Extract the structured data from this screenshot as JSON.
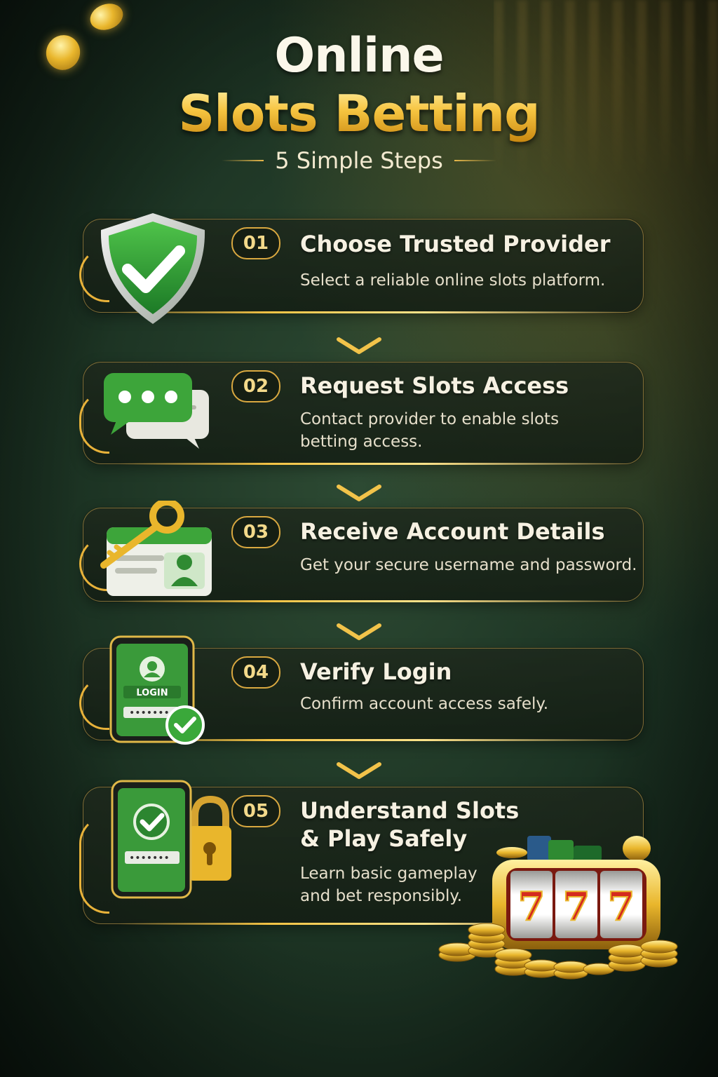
{
  "header": {
    "title_line1": "Online",
    "title_line2": "Slots Betting",
    "subtitle": "5 Simple Steps"
  },
  "steps": [
    {
      "number": "01",
      "title": "Choose Trusted Provider",
      "description": "Select a reliable online slots platform.",
      "icon": "shield-check-icon"
    },
    {
      "number": "02",
      "title": "Request Slots Access",
      "description": "Contact provider to enable slots\nbetting access.",
      "icon": "chat-bubbles-icon"
    },
    {
      "number": "03",
      "title": "Receive Account Details",
      "description": "Get your secure username and password.",
      "icon": "key-id-card-icon"
    },
    {
      "number": "04",
      "title": "Verify Login",
      "description": "Confirm account access safely.",
      "icon": "phone-login-icon",
      "icon_text": "LOGIN"
    },
    {
      "number": "05",
      "title": "Understand Slots\n& Play Safely",
      "description": "Learn basic gameplay\nand bet responsibly.",
      "icon": "phone-lock-icon"
    }
  ],
  "slot_machine": {
    "reels": "777",
    "icon": "slot-machine-icon"
  },
  "colors": {
    "gold": "#f2c34a",
    "green": "#3aa83a",
    "background": "#1c3323",
    "text": "#f6f1e2"
  }
}
